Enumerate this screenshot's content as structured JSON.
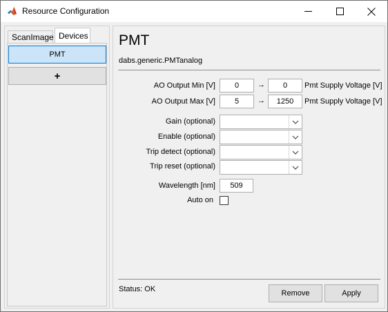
{
  "window": {
    "title": "Resource Configuration",
    "icon": "matlab-icon",
    "controls": [
      "minimize-icon",
      "maximize-icon",
      "close-icon"
    ]
  },
  "sidebar": {
    "tabs": [
      {
        "label": "ScanImage",
        "active": false
      },
      {
        "label": "Devices",
        "active": true
      }
    ],
    "devices": [
      {
        "label": "PMT",
        "selected": true
      }
    ],
    "add_label": "+"
  },
  "main": {
    "title": "PMT",
    "class_name": "dabs.generic.PMTanalog",
    "ao_min": {
      "label": "AO Output Min [V]",
      "from": "0",
      "arrow": "→",
      "to": "0",
      "unit": "Pmt Supply Voltage [V]"
    },
    "ao_max": {
      "label": "AO Output Max [V]",
      "from": "5",
      "arrow": "→",
      "to": "1250",
      "unit": "Pmt Supply Voltage [V]"
    },
    "dropdowns": [
      {
        "label": "Gain (optional)",
        "value": ""
      },
      {
        "label": "Enable (optional)",
        "value": ""
      },
      {
        "label": "Trip detect (optional)",
        "value": ""
      },
      {
        "label": "Trip reset (optional)",
        "value": ""
      }
    ],
    "wavelength": {
      "label": "Wavelength [nm]",
      "value": "509"
    },
    "auto_on": {
      "label": "Auto on",
      "checked": false
    },
    "status": "Status: OK",
    "buttons": {
      "remove": "Remove",
      "apply": "Apply"
    }
  },
  "colors": {
    "selected_fill": "#cce4f7",
    "selected_border": "#0078d7",
    "window_bg": "#f0f0f0"
  }
}
